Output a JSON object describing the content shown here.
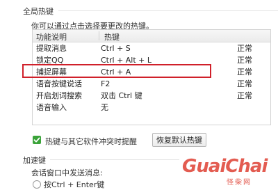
{
  "global_hotkeys": {
    "title": "全局热键",
    "hint": "你可以通过点击选择要更改的热键。",
    "table": {
      "headers": [
        "功能说明",
        "热键"
      ],
      "rows": [
        {
          "func": "提取消息",
          "key": "Ctrl + S",
          "status": "正常"
        },
        {
          "func": "锁定QQ",
          "key": "Ctrl + Alt + L",
          "status": "正常"
        },
        {
          "func": "捕捉屏幕",
          "key": "Ctrl + A",
          "status": "正常"
        },
        {
          "func": "语音按键说话",
          "key": "F2",
          "status": "正常"
        },
        {
          "func": "开启划词搜索",
          "key": "双击 Ctrl 键",
          "status": "正常"
        },
        {
          "func": "语音输入",
          "key": "无",
          "status": ""
        }
      ]
    },
    "conflict_checkbox": {
      "label": "热键与其它软件冲突时提醒",
      "checked": true
    },
    "restore_button": "恢复默认热键"
  },
  "accelerator": {
    "title": "加速键",
    "send_label": "会话窗口中发送消息:",
    "option_label": "按Ctrl + Enter键"
  },
  "watermark": {
    "main": "GuaiChai",
    "sub": "怪柴网"
  },
  "colors": {
    "highlight": "#d0202a",
    "check": "#3aa339"
  }
}
